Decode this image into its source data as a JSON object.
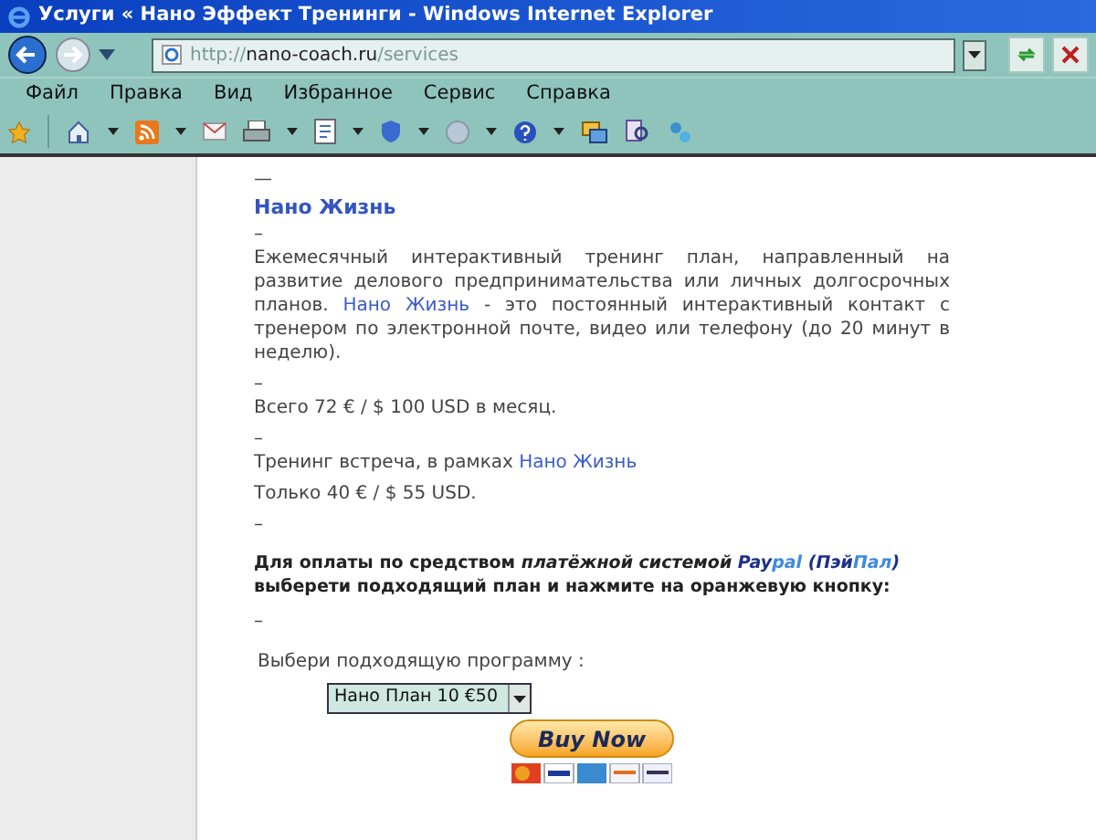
{
  "window": {
    "title": "Услуги « Нано Эффект Тренинги - Windows Internet Explorer"
  },
  "address_bar": {
    "url_prefix": "http://",
    "url_host": "nano-coach.ru",
    "url_path": "/services"
  },
  "menu": [
    "Файл",
    "Правка",
    "Вид",
    "Избранное",
    "Сервис",
    "Справка"
  ],
  "content": [
    {
      "kind": "dash",
      "text": "—"
    },
    {
      "kind": "heading",
      "text": "Нано Жизнь"
    },
    {
      "kind": "dash",
      "text": "–"
    },
    {
      "kind": "paragraph",
      "segments": [
        {
          "kind": "plain",
          "text": "Ежемесячный интерактивный тренинг план, направленный на развитие делового предпринимательства или личных долгосрочных планов. "
        },
        {
          "kind": "link",
          "text": "Нано Жизнь"
        },
        {
          "kind": "plain",
          "text": " - это постоянный интерактивный контакт с тренером по электронной почте, видео или телефону (до 20 минут в неделю)."
        }
      ]
    },
    {
      "kind": "dash",
      "text": "–"
    },
    {
      "kind": "paragraph",
      "segments": [
        {
          "kind": "plain",
          "text": "Всего 72 € / $ 100 USD в месяц."
        }
      ]
    },
    {
      "kind": "dash",
      "text": "–"
    },
    {
      "kind": "paragraph",
      "segments": [
        {
          "kind": "plain",
          "text": "Тренинг встреча, в рамках "
        },
        {
          "kind": "link",
          "text": "Нано Жизнь"
        }
      ]
    },
    {
      "kind": "paragraph",
      "segments": [
        {
          "kind": "plain",
          "text": "Только 40 € / $ 55 USD."
        }
      ]
    },
    {
      "kind": "dash",
      "text": "–"
    },
    {
      "kind": "paragraph",
      "segments": [
        {
          "kind": "bold",
          "text": "Для оплаты по средством "
        },
        {
          "kind": "bold-italic",
          "text": "платёжной системой "
        },
        {
          "kind": "brand-dark",
          "text": "Pay"
        },
        {
          "kind": "brand-light",
          "text": "pal"
        },
        {
          "kind": "brand-dark",
          "text": " (Пэй"
        },
        {
          "kind": "brand-light",
          "text": "Пал"
        },
        {
          "kind": "brand-dark",
          "text": ")"
        },
        {
          "kind": "bold",
          "text": " выберети подходящий план и нажмите на оранжевую кнопку:"
        }
      ]
    },
    {
      "kind": "dash",
      "text": "–"
    }
  ],
  "form": {
    "label": "Выбери подходящую программу :",
    "select_value": "Нано План 10 €50",
    "button": "Buy Now"
  }
}
